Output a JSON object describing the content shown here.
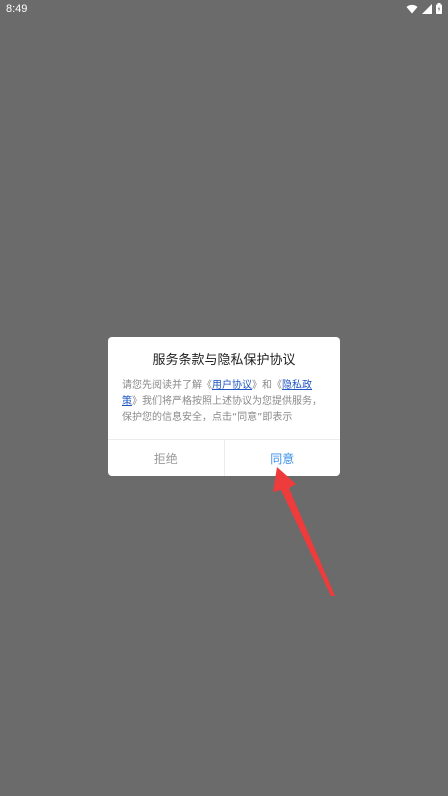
{
  "status_bar": {
    "time": "8:49"
  },
  "dialog": {
    "title": "服务条款与隐私保护协议",
    "body": {
      "t1": "请您先阅读并了解",
      "t2": "《",
      "link_user": "用户协议",
      "t3": "》和",
      "t4": "《",
      "link_privacy": "隐私政策",
      "t5": "》我们将严格按照上述协议为您提供服务，保护您的信息安全，点击“同意”即表示"
    },
    "reject_label": "拒绝",
    "agree_label": "同意"
  },
  "colors": {
    "overlay": "#6b6b6b",
    "link": "#1f56c2",
    "agree": "#3b8fe8",
    "arrow": "#ee3b3b"
  }
}
